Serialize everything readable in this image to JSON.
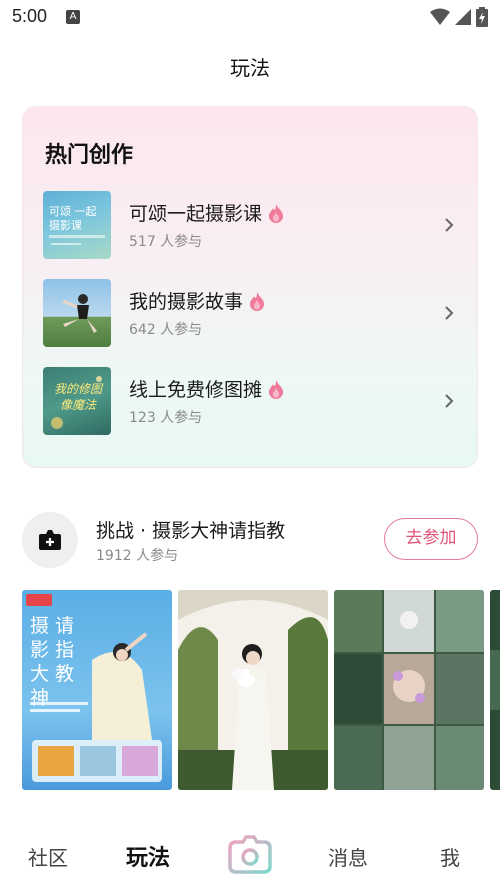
{
  "status_bar": {
    "time": "5:00",
    "badge": "A"
  },
  "page_title": "玩法",
  "hot": {
    "title": "热门创作",
    "items": [
      {
        "name": "可颂一起摄影课",
        "count": "517 人参与",
        "thumb_text": "可颂 一起摄影课"
      },
      {
        "name": "我的摄影故事",
        "count": "642 人参与"
      },
      {
        "name": "线上免费修图摊",
        "count": "123 人参与",
        "thumb_text": "我的修图 像魔法"
      }
    ]
  },
  "challenge": {
    "title": "挑战 · 摄影大神请指教",
    "count": "1912 人参与",
    "join_label": "去参加"
  },
  "gallery": {
    "poster_text": "摄 请 影 指 大 教 神"
  },
  "nav": {
    "community": "社区",
    "play": "玩法",
    "messages": "消息",
    "me": "我"
  },
  "colors": {
    "accent": "#e0557a",
    "card_top": "#fde6ee",
    "card_bottom": "#e8f8f4"
  }
}
